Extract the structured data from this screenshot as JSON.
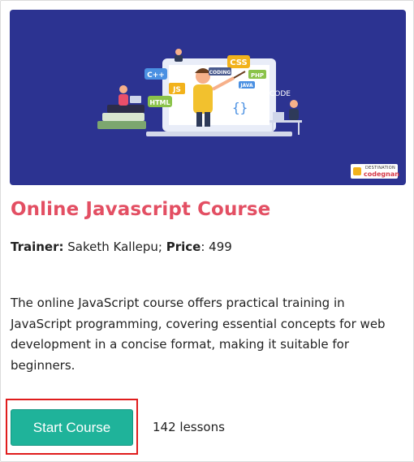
{
  "course": {
    "title": "Online Javascript Course",
    "trainer_label": "Trainer:",
    "trainer_name": "Saketh Kallepu;",
    "price_label": "Price",
    "price_value": ": 499",
    "description": "The online JavaScript course offers practical training in JavaScript programming, covering essential concepts for web development in a concise format, making it suitable for beginners.",
    "start_button_label": "Start Course",
    "lessons": "142 lessons"
  },
  "banner": {
    "tags": [
      "C++",
      "CSS",
      "JS",
      "CODING",
      "PHP",
      "JAVA",
      "HTML",
      "CODE"
    ],
    "brand_line1": "DESTINATION",
    "brand_line2": "codegnan"
  },
  "colors": {
    "banner_bg": "#2c3391",
    "title": "#e34f63",
    "button": "#1fb39a",
    "highlight": "#e01d1d"
  }
}
